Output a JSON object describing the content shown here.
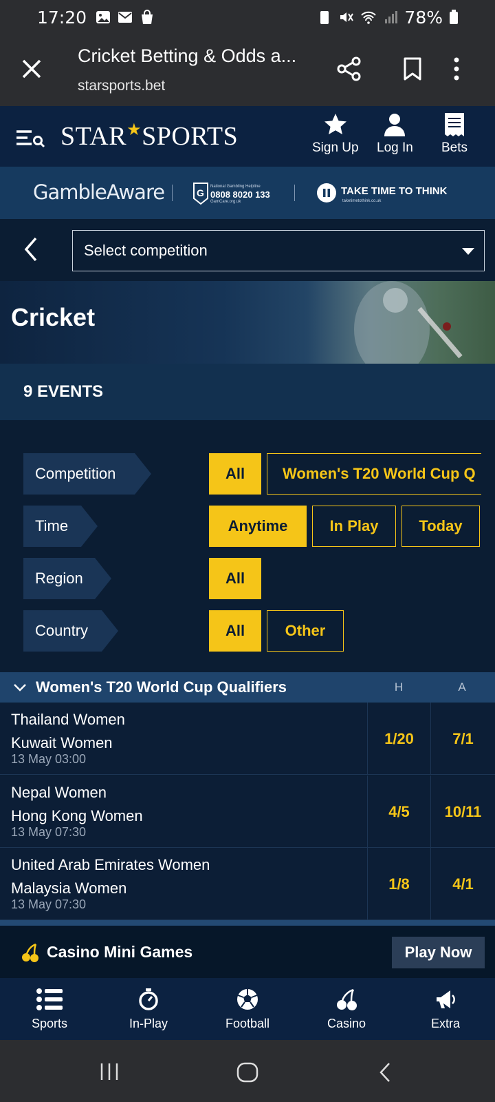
{
  "status_bar": {
    "time": "17:20",
    "battery": "78%"
  },
  "browser": {
    "title": "Cricket Betting & Odds a...",
    "url": "starsports.bet"
  },
  "site_header": {
    "logo_left": "STAR",
    "logo_star": "★",
    "logo_right": "SPORTS",
    "signup_label": "Sign Up",
    "login_label": "Log In",
    "bets_label": "Bets"
  },
  "gamble_bar": {
    "gambleaware": "GambleAware",
    "helpline_caption": "National Gambling Helpline",
    "helpline_number": "0808 8020 133",
    "helpline_url": "GamCare.org.uk",
    "ttt_label": "TAKE TIME TO THINK",
    "ttt_url": "taketimetothink.co.uk"
  },
  "selector": {
    "placeholder": "Select competition"
  },
  "hero": {
    "title": "Cricket"
  },
  "events": {
    "count_label": "9 EVENTS"
  },
  "filters": {
    "competition": {
      "label": "Competition",
      "options": [
        "All",
        "Women's T20 World Cup Q"
      ]
    },
    "time": {
      "label": "Time",
      "options": [
        "Anytime",
        "In Play",
        "Today"
      ]
    },
    "region": {
      "label": "Region",
      "options": [
        "All"
      ]
    },
    "country": {
      "label": "Country",
      "options": [
        "All",
        "Other"
      ]
    }
  },
  "group": {
    "title": "Women's T20 World Cup Qualifiers",
    "col_home": "H",
    "col_away": "A"
  },
  "event_rows": [
    {
      "home": "Thailand Women",
      "away": "Kuwait Women",
      "time": "13 May 03:00",
      "odds_home": "1/20",
      "odds_away": "7/1"
    },
    {
      "home": "Nepal Women",
      "away": "Hong Kong Women",
      "time": "13 May 07:30",
      "odds_home": "4/5",
      "odds_away": "10/11"
    },
    {
      "home": "United Arab Emirates Women",
      "away": "Malaysia Women",
      "time": "13 May 07:30",
      "odds_home": "1/8",
      "odds_away": "4/1"
    }
  ],
  "promo": {
    "title": "Casino Mini Games",
    "button": "Play Now"
  },
  "bottom_nav": [
    {
      "label": "Sports",
      "icon": "list-icon"
    },
    {
      "label": "In-Play",
      "icon": "stopwatch-icon"
    },
    {
      "label": "Football",
      "icon": "football-icon"
    },
    {
      "label": "Casino",
      "icon": "cherries-icon"
    },
    {
      "label": "Extra",
      "icon": "megaphone-icon"
    }
  ],
  "colors": {
    "accent": "#f5c518",
    "navy": "#0b1d33",
    "header": "#0c2241"
  }
}
